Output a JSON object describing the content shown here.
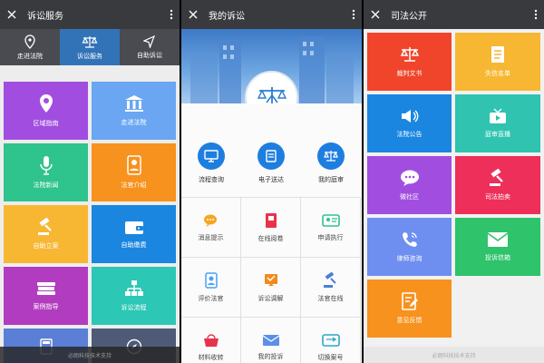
{
  "screen1": {
    "title": "诉讼服务",
    "nav": [
      {
        "label": "走进法院",
        "icon": "location-pin-icon"
      },
      {
        "label": "诉讼服务",
        "icon": "scales-icon"
      },
      {
        "label": "自助诉讼",
        "icon": "navigation-arrow-icon"
      }
    ],
    "tiles": [
      {
        "label": "区域指南",
        "icon": "location-pin-icon",
        "color": "#a14ee0"
      },
      {
        "label": "走进法院",
        "icon": "courthouse-icon",
        "color": "#6aa6f2"
      },
      {
        "label": "法院新闻",
        "icon": "microphone-icon",
        "color": "#2fc38d"
      },
      {
        "label": "法官介绍",
        "icon": "judge-icon",
        "color": "#f7921e"
      },
      {
        "label": "自助立案",
        "icon": "gavel-icon",
        "color": "#f7b733"
      },
      {
        "label": "自助缴费",
        "icon": "wallet-icon",
        "color": "#1a86e0"
      },
      {
        "label": "案例指导",
        "icon": "books-icon",
        "color": "#b23cbf"
      },
      {
        "label": "诉讼流程",
        "icon": "flowchart-icon",
        "color": "#2cc7b5"
      }
    ],
    "footer": "必朗科技技术支持"
  },
  "screen2": {
    "title": "我的诉讼",
    "circle_buttons": [
      {
        "label": "流程查询",
        "icon": "monitor-icon"
      },
      {
        "label": "电子送达",
        "icon": "document-icon"
      },
      {
        "label": "我的庭审",
        "icon": "scales-icon"
      }
    ],
    "cells": [
      {
        "label": "消息提示",
        "icon": "chat-bubbles-icon",
        "color": "#f5a623"
      },
      {
        "label": "在线阅卷",
        "icon": "book-icon",
        "color": "#e8334a"
      },
      {
        "label": "申请执行",
        "icon": "id-card-icon",
        "color": "#2fc38d"
      },
      {
        "label": "评价法官",
        "icon": "judge-icon",
        "color": "#4aa3f0"
      },
      {
        "label": "诉讼调解",
        "icon": "pen-paper-icon",
        "color": "#f08c1e"
      },
      {
        "label": "法官在线",
        "icon": "gavel-icon",
        "color": "#4a7fd8"
      },
      {
        "label": "材料收转",
        "icon": "basket-icon",
        "color": "#e8334a"
      },
      {
        "label": "我的投诉",
        "icon": "envelope-icon",
        "color": "#5b8fe8"
      },
      {
        "label": "切换案号",
        "icon": "switch-card-icon",
        "color": "#2fa7c7"
      }
    ]
  },
  "screen3": {
    "title": "司法公开",
    "tiles": [
      {
        "label": "裁判文书",
        "icon": "scales-icon",
        "color": "#f0452b"
      },
      {
        "label": "失信名单",
        "icon": "list-document-icon",
        "color": "#f7b733"
      },
      {
        "label": "法院公告",
        "icon": "speaker-icon",
        "color": "#1a86e0"
      },
      {
        "label": "庭审直播",
        "icon": "tv-icon",
        "color": "#2fc3b0"
      },
      {
        "label": "微社区",
        "icon": "chat-bubble-icon",
        "color": "#a14ee0"
      },
      {
        "label": "司法拍卖",
        "icon": "gavel-icon",
        "color": "#ee2f5a"
      },
      {
        "label": "律师咨询",
        "icon": "phone-icon",
        "color": "#6e8ff0"
      },
      {
        "label": "投诉信箱",
        "icon": "envelope-icon",
        "color": "#2fc36b"
      },
      {
        "label": "意见反馈",
        "icon": "edit-note-icon",
        "color": "#f7921e"
      }
    ],
    "footer": "必朗科技技术支持"
  }
}
